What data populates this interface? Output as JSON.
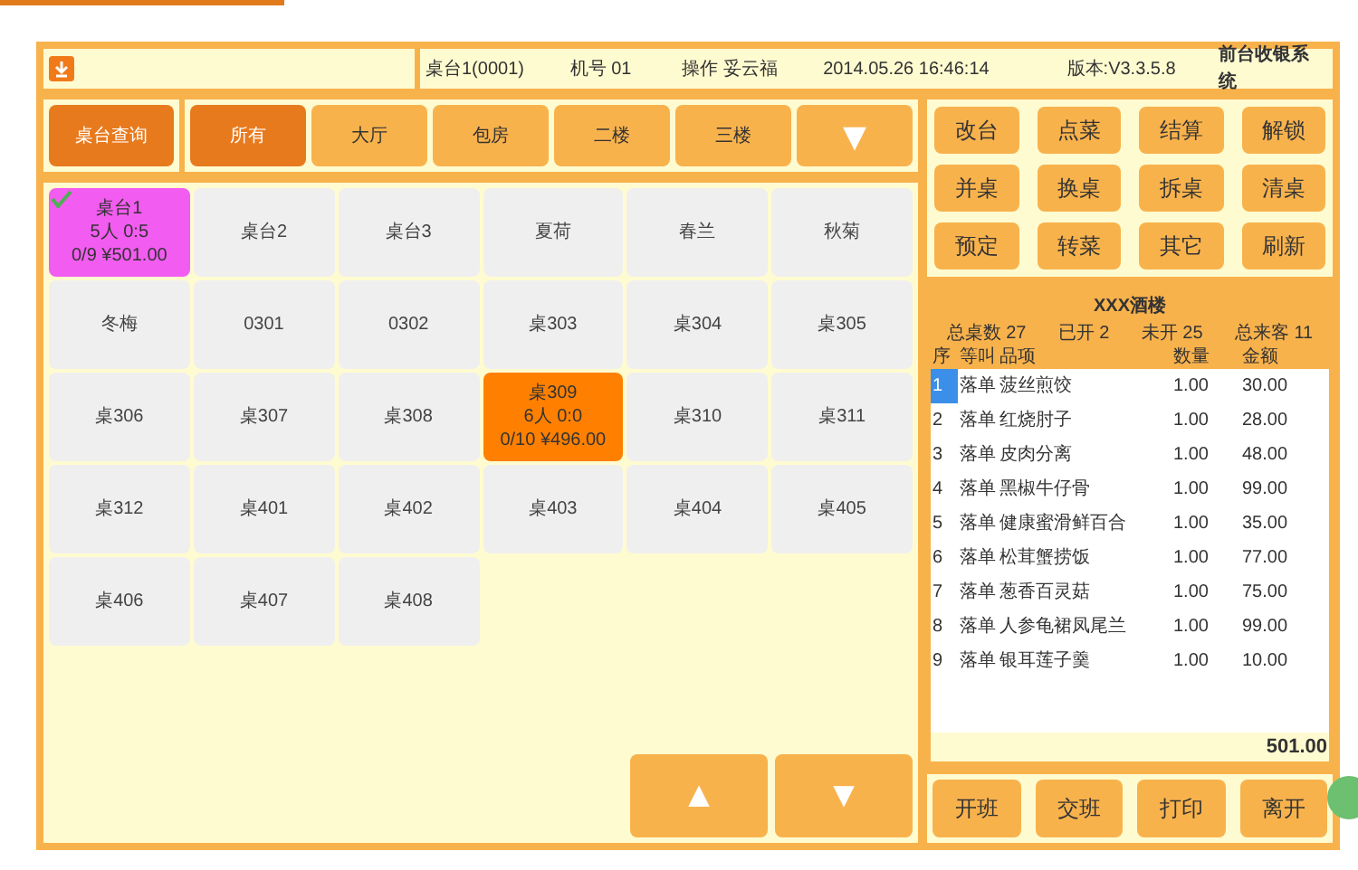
{
  "header": {
    "table": "桌台1(0001)",
    "machine": "机号 01",
    "operator": "操作 妥云福",
    "datetime": "2014.05.26 16:46:14",
    "version": "版本:V3.3.5.8",
    "system": "前台收银系统"
  },
  "search_button": "桌台查询",
  "categories": [
    {
      "label": "所有",
      "selected": true
    },
    {
      "label": "大厅",
      "selected": false
    },
    {
      "label": "包房",
      "selected": false
    },
    {
      "label": "二楼",
      "selected": false
    },
    {
      "label": "三楼",
      "selected": false
    }
  ],
  "category_more": "▼",
  "tables": [
    {
      "lines": [
        "桌台1",
        "5人 0:5",
        "0/9 ¥501.00"
      ],
      "kind": "open",
      "selected": true
    },
    {
      "lines": [
        "桌台2"
      ],
      "kind": "free",
      "selected": false
    },
    {
      "lines": [
        "桌台3"
      ],
      "kind": "free",
      "selected": false
    },
    {
      "lines": [
        "夏荷"
      ],
      "kind": "free",
      "selected": false
    },
    {
      "lines": [
        "春兰"
      ],
      "kind": "free",
      "selected": false
    },
    {
      "lines": [
        "秋菊"
      ],
      "kind": "free",
      "selected": false
    },
    {
      "lines": [
        "冬梅"
      ],
      "kind": "free",
      "selected": false
    },
    {
      "lines": [
        "0301"
      ],
      "kind": "free",
      "selected": false
    },
    {
      "lines": [
        "0302"
      ],
      "kind": "free",
      "selected": false
    },
    {
      "lines": [
        "桌303"
      ],
      "kind": "free",
      "selected": false
    },
    {
      "lines": [
        "桌304"
      ],
      "kind": "free",
      "selected": false
    },
    {
      "lines": [
        "桌305"
      ],
      "kind": "free",
      "selected": false
    },
    {
      "lines": [
        "桌306"
      ],
      "kind": "free",
      "selected": false
    },
    {
      "lines": [
        "桌307"
      ],
      "kind": "free",
      "selected": false
    },
    {
      "lines": [
        "桌308"
      ],
      "kind": "free",
      "selected": false
    },
    {
      "lines": [
        "桌309",
        "6人 0:0",
        "0/10 ¥496.00"
      ],
      "kind": "busy",
      "selected": false
    },
    {
      "lines": [
        "桌310"
      ],
      "kind": "free",
      "selected": false
    },
    {
      "lines": [
        "桌311"
      ],
      "kind": "free",
      "selected": false
    },
    {
      "lines": [
        "桌312"
      ],
      "kind": "free",
      "selected": false
    },
    {
      "lines": [
        "桌401"
      ],
      "kind": "free",
      "selected": false
    },
    {
      "lines": [
        "桌402"
      ],
      "kind": "free",
      "selected": false
    },
    {
      "lines": [
        "桌403"
      ],
      "kind": "free",
      "selected": false
    },
    {
      "lines": [
        "桌404"
      ],
      "kind": "free",
      "selected": false
    },
    {
      "lines": [
        "桌405"
      ],
      "kind": "free",
      "selected": false
    },
    {
      "lines": [
        "桌406"
      ],
      "kind": "free",
      "selected": false
    },
    {
      "lines": [
        "桌407"
      ],
      "kind": "free",
      "selected": false
    },
    {
      "lines": [
        "桌408"
      ],
      "kind": "free",
      "selected": false
    }
  ],
  "pager": [
    "▲",
    "▼"
  ],
  "actions": [
    "改台",
    "点菜",
    "结算",
    "解锁",
    "并桌",
    "换桌",
    "拆桌",
    "清桌",
    "预定",
    "转菜",
    "其它",
    "刷新"
  ],
  "order": {
    "restaurant": "XXX酒楼",
    "stats": [
      "总桌数 27",
      "已开 2",
      "未开 25",
      "总来客 11"
    ],
    "columns": [
      "序",
      "等叫",
      "品项",
      "数量",
      "金额"
    ],
    "rows": [
      {
        "cells": [
          "1",
          "落单",
          "菠丝煎饺",
          "1.00",
          "30.00"
        ],
        "selected": true
      },
      {
        "cells": [
          "2",
          "落单",
          "红烧肘子",
          "1.00",
          "28.00"
        ],
        "selected": false
      },
      {
        "cells": [
          "3",
          "落单",
          "皮肉分离",
          "1.00",
          "48.00"
        ],
        "selected": false
      },
      {
        "cells": [
          "4",
          "落单",
          "黑椒牛仔骨",
          "1.00",
          "99.00"
        ],
        "selected": false
      },
      {
        "cells": [
          "5",
          "落单",
          "健康蜜滑鲜百合",
          "1.00",
          "35.00"
        ],
        "selected": false
      },
      {
        "cells": [
          "6",
          "落单",
          "松茸蟹捞饭",
          "1.00",
          "77.00"
        ],
        "selected": false
      },
      {
        "cells": [
          "7",
          "落单",
          "葱香百灵菇",
          "1.00",
          "75.00"
        ],
        "selected": false
      },
      {
        "cells": [
          "8",
          "落单",
          "人参龟裙凤尾兰",
          "1.00",
          "99.00"
        ],
        "selected": false
      },
      {
        "cells": [
          "9",
          "落单",
          "银耳莲子羹",
          "1.00",
          "10.00"
        ],
        "selected": false
      }
    ],
    "total": "501.00"
  },
  "footer_buttons": [
    "开班",
    "交班",
    "打印",
    "离开"
  ]
}
